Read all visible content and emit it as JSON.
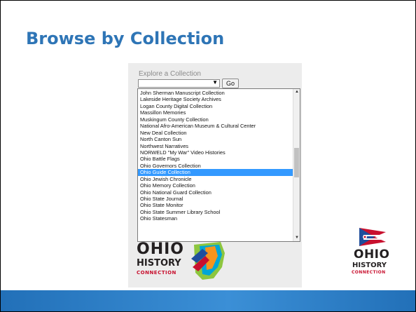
{
  "slide": {
    "title": "Browse by Collection"
  },
  "widget": {
    "label": "Explore a Collection",
    "select_value": "",
    "select_arrow": "▼",
    "go_label": "Go"
  },
  "dropdown": {
    "items": [
      "John Sherman Manuscript Collection",
      "Lakeside Heritage Society Archives",
      "Logan County Digital Collection",
      "Massillon Memories",
      "Muskingum County Collection",
      "National Afro-American Museum & Cultural Center",
      "New Deal Collection",
      "North Canton Sun",
      "Northwest Narratives",
      "NORWELD \"My War\" Video Histories",
      "Ohio Battle Flags",
      "Ohio Governors Collection",
      "Ohio Guide Collection",
      "Ohio Jewish Chronicle",
      "Ohio Memory Collection",
      "Ohio National Guard Collection",
      "Ohio State Journal",
      "Ohio State Monitor",
      "Ohio State Summer Library School",
      "Ohio Statesman"
    ],
    "selected_item": "Ohio Guide Collection",
    "scroll_up_glyph": "▲",
    "scroll_down_glyph": "▼"
  },
  "logo_partial": {
    "word1": "OHIO",
    "word2": "HISTORY",
    "word3": "CONNECTION"
  },
  "logo_right": {
    "word1": "OHIO",
    "word2": "HISTORY",
    "word3": "CONNECTION"
  },
  "colors": {
    "title": "#2e75b6",
    "selection": "#3399ff",
    "band": "#2270b8",
    "logo_red": "#c8102e",
    "logo_blue": "#1f4e9c"
  }
}
